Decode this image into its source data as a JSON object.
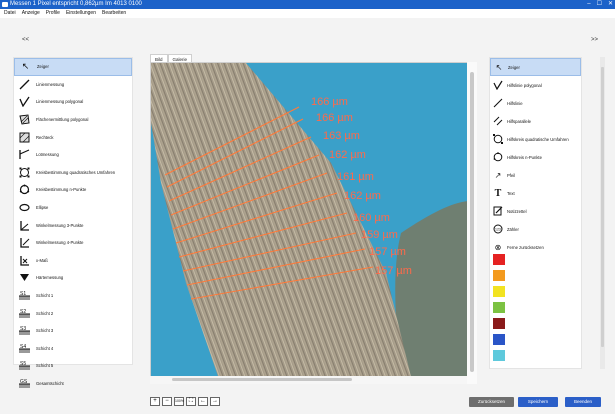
{
  "window": {
    "title": "Messen 1 Pixel entspricht 0,862µm  Im 4013 0100",
    "controls": [
      "–",
      "☐",
      "✕"
    ]
  },
  "menu": [
    "Datei",
    "Anzeige",
    "Profile",
    "Einstellungen",
    "Bearbeiten"
  ],
  "collapse_left": "<<",
  "collapse_right": ">>",
  "left_tools": [
    {
      "label": "Zeiger",
      "icon": "pointer-arrow-icon",
      "selected": true
    },
    {
      "label": "Linienmessung",
      "icon": "line-measure-icon"
    },
    {
      "label": "Linienmessung polygonal",
      "icon": "polyline-measure-icon"
    },
    {
      "label": "Flächenermittlung polygonal",
      "icon": "polygon-area-icon"
    },
    {
      "label": "Rechteck",
      "icon": "rectangle-icon"
    },
    {
      "label": "Lotmessung",
      "icon": "perpendicular-icon"
    },
    {
      "label": "Kreisbestimmung quadratisches Umfahren",
      "icon": "circle-square-icon"
    },
    {
      "label": "Kreisbestimmung n-Punkte",
      "icon": "circle-npoints-icon"
    },
    {
      "label": "Ellipse",
      "icon": "ellipse-icon"
    },
    {
      "label": "Winkelmessung 3-Punkte",
      "icon": "angle-3point-icon"
    },
    {
      "label": "Winkelmessung 4-Punkte",
      "icon": "angle-4point-icon"
    },
    {
      "label": "x-Maß",
      "icon": "x-dimension-icon"
    },
    {
      "label": "Härtemessung",
      "icon": "hardness-icon"
    },
    {
      "label": "Schicht 1",
      "icon": "layer-1-icon"
    },
    {
      "label": "Schicht 2",
      "icon": "layer-2-icon"
    },
    {
      "label": "Schicht 3",
      "icon": "layer-3-icon"
    },
    {
      "label": "Schicht 4",
      "icon": "layer-4-icon"
    },
    {
      "label": "Schicht 5",
      "icon": "layer-5-icon"
    },
    {
      "label": "Gesamtschicht",
      "icon": "total-layer-icon"
    }
  ],
  "right_tools": [
    {
      "label": "Zeiger",
      "icon": "pointer-arrow-icon",
      "selected": true
    },
    {
      "label": "Hilfslinie polygonal",
      "icon": "polyline-helper-icon"
    },
    {
      "label": "Hilfslinie",
      "icon": "helper-line-icon"
    },
    {
      "label": "Hilfsparallele",
      "icon": "parallel-helper-icon"
    },
    {
      "label": "Hilfskreis quadratische Umfahren",
      "icon": "circle-helper-icon"
    },
    {
      "label": "Hilfskreis n-Punkte",
      "icon": "circle-npoints-helper-icon"
    },
    {
      "label": "Pfeil",
      "icon": "arrow-icon"
    },
    {
      "label": "Text",
      "icon": "text-icon"
    },
    {
      "label": "Notizzettel",
      "icon": "note-icon"
    },
    {
      "label": "Zähler",
      "icon": "counter-icon"
    },
    {
      "label": "Ferne zurücksetzen",
      "icon": "reset-icon"
    }
  ],
  "colors": [
    "#e52222",
    "#f39a1e",
    "#f2e321",
    "#7cc242",
    "#8a1a1a",
    "#2a55c7",
    "#5ec9dc"
  ],
  "tabs": [
    {
      "label": "Bild",
      "active": true
    },
    {
      "label": "Galerie",
      "active": false
    }
  ],
  "measurements": [
    "166 µm",
    "166 µm",
    "163 µm",
    "162 µm",
    "161 µm",
    "162 µm",
    "160 µm",
    "159 µm",
    "157 µm",
    "157 µm"
  ],
  "zoom_buttons": [
    "+",
    "−",
    "100%",
    "⛶",
    "←",
    "→"
  ],
  "buttons": {
    "reset": "Zurücksetzen",
    "save": "Speichern",
    "finish": "Beenden"
  },
  "button_colors": {
    "reset": "#6e6e6e",
    "save": "#2b5fc8",
    "finish": "#2b5fc8"
  }
}
